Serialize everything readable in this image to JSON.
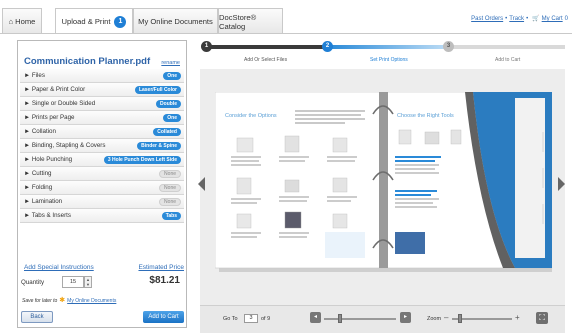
{
  "tabs": [
    {
      "label": "Home"
    },
    {
      "label": "Upload & Print",
      "badge": "1"
    },
    {
      "label": "My Online Documents"
    },
    {
      "label": "DocStore® Catalog"
    }
  ],
  "top_links": {
    "past_orders": "Past Orders",
    "track": "Track",
    "my_cart": "My Cart",
    "cart_count": "0"
  },
  "document": {
    "title": "Communication Planner.pdf",
    "rename": "rename"
  },
  "options": [
    {
      "label": "Files",
      "value": "One",
      "style": "blue"
    },
    {
      "label": "Paper & Print Color",
      "value": "Laser/Full Color",
      "style": "blue"
    },
    {
      "label": "Single or Double Sided",
      "value": "Double",
      "style": "blue"
    },
    {
      "label": "Prints per Page",
      "value": "One",
      "style": "blue"
    },
    {
      "label": "Collation",
      "value": "Collated",
      "style": "blue"
    },
    {
      "label": "Binding, Stapling & Covers",
      "value": "Binder & Spine",
      "style": "blue"
    },
    {
      "label": "Hole Punching",
      "value": "3 Hole Punch Down Left Side",
      "style": "blue"
    },
    {
      "label": "Cutting",
      "value": "None",
      "style": "grey"
    },
    {
      "label": "Folding",
      "value": "None",
      "style": "grey"
    },
    {
      "label": "Lamination",
      "value": "None",
      "style": "grey"
    },
    {
      "label": "Tabs & Inserts",
      "value": "Tabs",
      "style": "blue"
    }
  ],
  "order": {
    "add_instructions": "Add Special Instructions",
    "estimated_price": "Estimated Price",
    "quantity_label": "Quantity",
    "quantity": "15",
    "price": "$81.21",
    "save_prefix": "Save for later to",
    "save_link": "My Online Documents",
    "back": "Back",
    "add_to_cart": "Add to Cart"
  },
  "steps": [
    {
      "number": "1",
      "label": "Add Or Select Files",
      "state": "done"
    },
    {
      "number": "2",
      "label": "Set Print Options",
      "state": "current"
    },
    {
      "number": "3",
      "label": "Add to Cart",
      "state": "pending"
    }
  ],
  "preview": {
    "left_heading": "Consider the Options",
    "right_heading": "Choose the Right Tools",
    "goto_label": "Go To",
    "page": "3",
    "of_label": "of 9",
    "zoom_label": "Zoom"
  },
  "colors": {
    "accent_blue": "#1f7fd5",
    "link_blue": "#2e6db8",
    "title_blue": "#2f64a8",
    "step_done": "#3a3a3a",
    "step_pending": "#888888"
  },
  "icons": {
    "home": "home-icon",
    "cart": "cart-icon",
    "prev": "chevron-left-icon",
    "next": "chevron-right-icon",
    "star": "star-icon",
    "fullscreen": "fullscreen-icon"
  }
}
